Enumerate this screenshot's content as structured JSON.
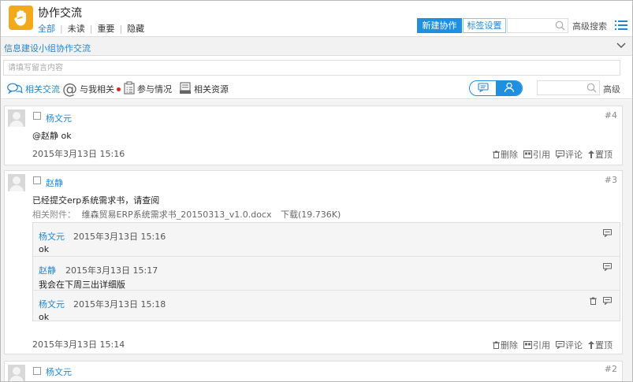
{
  "header": {
    "title": "协作交流",
    "filters": [
      "全部",
      "未读",
      "重要",
      "隐藏"
    ],
    "new_button": "新建协作",
    "tag_button": "标签设置",
    "advanced_search": "高级搜索",
    "accent_color": "#1f8fe0"
  },
  "group": {
    "title": "信息建设小组协作交流"
  },
  "composer": {
    "placeholder": "请填写留言内容"
  },
  "nav": {
    "tabs": [
      "相关交流",
      "与我相关",
      "参与情况",
      "相关资源"
    ],
    "advanced": "高级"
  },
  "posts": [
    {
      "author": "杨文元",
      "floor": "#4",
      "text": "@赵静 ok",
      "date": "2015年3月13日 15:16"
    },
    {
      "author": "赵静",
      "floor": "#3",
      "text": "已经提交erp系统需求书，请查阅",
      "attachment_label": "相关附件：",
      "attachment_file": "维森贸易ERP系统需求书_20150313_v1.0.docx",
      "attachment_download": "下载(19.736K)",
      "date": "2015年3月13日 15:14",
      "replies": [
        {
          "author": "杨文元",
          "date": "2015年3月13日 15:16",
          "text": "ok"
        },
        {
          "author": "赵静",
          "date": "2015年3月13日 15:17",
          "text": "我会在下周三出详细版"
        },
        {
          "author": "杨文元",
          "date": "2015年3月13日 15:18",
          "text": "ok"
        }
      ]
    },
    {
      "author": "杨文元",
      "floor": "#2"
    }
  ],
  "actions": {
    "delete": "删除",
    "quote": "引用",
    "comment": "评论",
    "top": "置顶"
  }
}
